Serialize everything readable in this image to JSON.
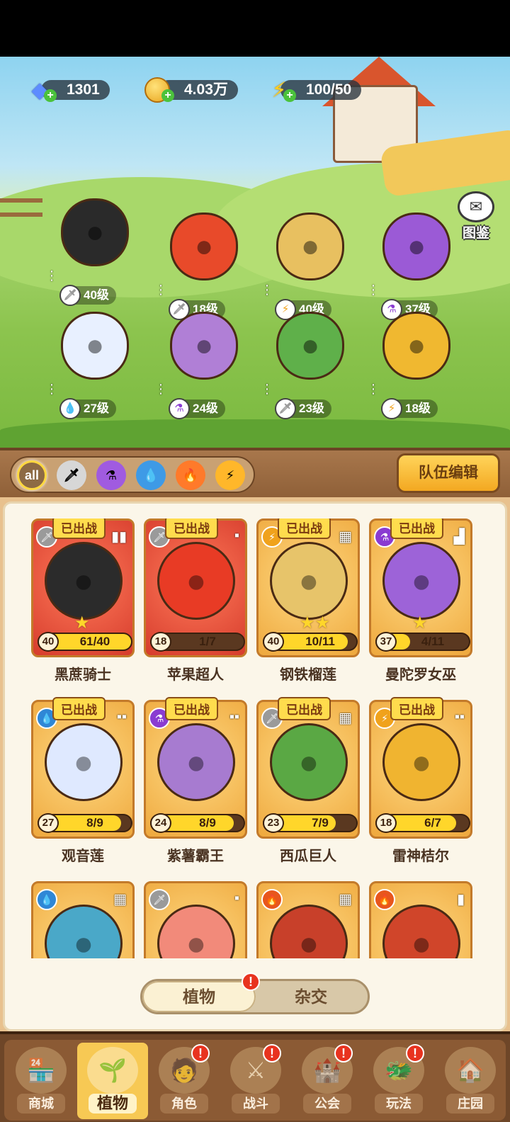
{
  "resources": {
    "gems": "1301",
    "coins": "4.03万",
    "energy": "100/50"
  },
  "album_label": "图鉴",
  "lineup": [
    {
      "level": "40级",
      "element": "sword",
      "element_icon": "🗡"
    },
    {
      "level": "18级",
      "element": "sword",
      "element_icon": "🗡"
    },
    {
      "level": "40级",
      "element": "lightning",
      "element_icon": "⚡"
    },
    {
      "level": "37级",
      "element": "potion",
      "element_icon": "⚗"
    },
    {
      "level": "27级",
      "element": "water",
      "element_icon": "💧"
    },
    {
      "level": "24级",
      "element": "potion",
      "element_icon": "⚗"
    },
    {
      "level": "23级",
      "element": "sword",
      "element_icon": "🗡"
    },
    {
      "level": "18级",
      "element": "lightning",
      "element_icon": "⚡"
    }
  ],
  "filters": [
    {
      "label": "all",
      "icon": "all"
    },
    {
      "label": "",
      "icon": "sword-icon"
    },
    {
      "label": "",
      "icon": "potion-icon"
    },
    {
      "label": "",
      "icon": "water-icon"
    },
    {
      "label": "",
      "icon": "fire-icon"
    },
    {
      "label": "",
      "icon": "lightning-icon"
    }
  ],
  "team_edit_label": "队伍编辑",
  "deployed_label": "已出战",
  "cards": [
    {
      "name": "黑蔗骑士",
      "level": "40",
      "progress": "61/40",
      "fill": 1.0,
      "element": "sword",
      "shape": "▮▮",
      "frame": "red",
      "stars": 1,
      "deployed": true
    },
    {
      "name": "苹果超人",
      "level": "18",
      "progress": "1/7",
      "fill": 0.14,
      "element": "sword",
      "shape": "▪",
      "frame": "red",
      "stars": 0,
      "deployed": true
    },
    {
      "name": "钢铁榴莲",
      "level": "40",
      "progress": "10/11",
      "fill": 0.91,
      "element": "lightning",
      "shape": "▦",
      "frame": "gold",
      "stars": 2,
      "deployed": true
    },
    {
      "name": "曼陀罗女巫",
      "level": "37",
      "progress": "4/11",
      "fill": 0.36,
      "element": "potion",
      "shape": "▟",
      "frame": "gold",
      "stars": 1,
      "deployed": true
    },
    {
      "name": "观音莲",
      "level": "27",
      "progress": "8/9",
      "fill": 0.89,
      "element": "water",
      "shape": "▪▪",
      "frame": "gold",
      "stars": 0,
      "deployed": true
    },
    {
      "name": "紫薯霸王",
      "level": "24",
      "progress": "8/9",
      "fill": 0.89,
      "element": "potion",
      "shape": "▪▪",
      "frame": "gold",
      "stars": 0,
      "deployed": true
    },
    {
      "name": "西瓜巨人",
      "level": "23",
      "progress": "7/9",
      "fill": 0.78,
      "element": "sword",
      "shape": "▦",
      "frame": "gold",
      "stars": 0,
      "deployed": true
    },
    {
      "name": "雷神桔尔",
      "level": "18",
      "progress": "6/7",
      "fill": 0.86,
      "element": "lightning",
      "shape": "▪▪",
      "frame": "gold",
      "stars": 0,
      "deployed": true
    },
    {
      "name": "",
      "level": "",
      "progress": "",
      "fill": 0,
      "element": "water",
      "shape": "▦",
      "frame": "gold",
      "stars": 0,
      "deployed": false
    },
    {
      "name": "",
      "level": "",
      "progress": "",
      "fill": 0,
      "element": "sword",
      "shape": "▪",
      "frame": "gold",
      "stars": 0,
      "deployed": false
    },
    {
      "name": "",
      "level": "",
      "progress": "",
      "fill": 0,
      "element": "fire",
      "shape": "▦",
      "frame": "gold",
      "stars": 0,
      "deployed": false
    },
    {
      "name": "",
      "level": "",
      "progress": "",
      "fill": 0,
      "element": "fire",
      "shape": "▮",
      "frame": "gold",
      "stars": 0,
      "deployed": false
    }
  ],
  "toggle": {
    "plants": "植物",
    "hybrid": "杂交",
    "alert": "!"
  },
  "nav": [
    {
      "label": "商城",
      "icon": "shop-icon",
      "glyph": "🏪",
      "active": false,
      "badge": false
    },
    {
      "label": "植物",
      "icon": "plants-icon",
      "glyph": "🌱",
      "active": true,
      "badge": false
    },
    {
      "label": "角色",
      "icon": "character-icon",
      "glyph": "🧑",
      "active": false,
      "badge": true
    },
    {
      "label": "战斗",
      "icon": "battle-icon",
      "glyph": "⚔",
      "active": false,
      "badge": true
    },
    {
      "label": "公会",
      "icon": "guild-icon",
      "glyph": "🏰",
      "active": false,
      "badge": true
    },
    {
      "label": "玩法",
      "icon": "gameplay-icon",
      "glyph": "🐲",
      "active": false,
      "badge": true
    },
    {
      "label": "庄园",
      "icon": "manor-icon",
      "glyph": "🏠",
      "active": false,
      "badge": false
    }
  ],
  "colors": {
    "sword": "#9a9a9a",
    "lightning": "#f0a21c",
    "potion": "#8a3bd1",
    "water": "#2f87d6",
    "fire": "#e8561c",
    "accent_gold": "#ffd62a",
    "badge_red": "#e8331f",
    "panel_brown": "#8f6038"
  }
}
